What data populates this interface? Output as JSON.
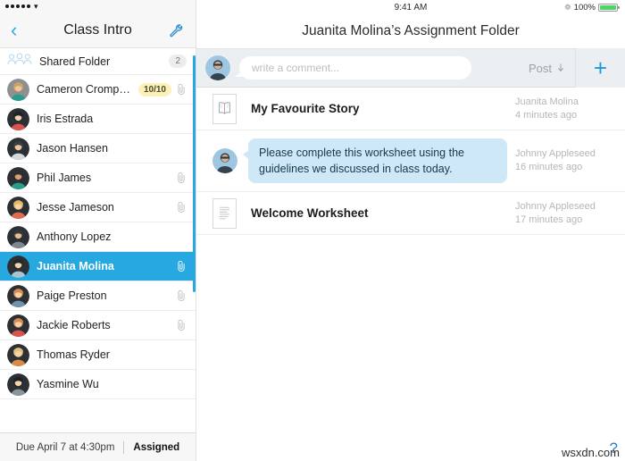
{
  "left": {
    "status_bar": {
      "signal_dots": 5,
      "wifi_icon": "wifi-icon"
    },
    "nav": {
      "back_icon": "back-chevron-icon",
      "title": "Class Intro",
      "settings_icon": "wrench-icon"
    },
    "shared_folder": {
      "icon": "group-people-icon",
      "label": "Shared Folder",
      "count": "2"
    },
    "students": [
      {
        "name": "Cameron Cromp…",
        "grade": "10/10",
        "attachment": true,
        "selected": false,
        "skin": "#f0c79a",
        "hair": "#c9a26b",
        "shirt": "#2a9d8f",
        "bg": "#8f8f8f"
      },
      {
        "name": "Iris Estrada",
        "grade": "",
        "attachment": false,
        "selected": false,
        "skin": "#f3d3ae",
        "hair": "#1f2226",
        "shirt": "#d9534f",
        "bg": "#2c3034"
      },
      {
        "name": "Jason Hansen",
        "grade": "",
        "attachment": false,
        "selected": false,
        "skin": "#f0c79a",
        "hair": "#3b3f45",
        "shirt": "#d6d9dc",
        "bg": "#2c3034"
      },
      {
        "name": "Phil James",
        "grade": "",
        "attachment": true,
        "selected": false,
        "skin": "#d8a06a",
        "hair": "#2b2f33",
        "shirt": "#2a9d8f",
        "bg": "#2c3034"
      },
      {
        "name": "Jesse Jameson",
        "grade": "",
        "attachment": true,
        "selected": false,
        "skin": "#f3d3ae",
        "hair": "#e3b85f",
        "shirt": "#e06a52",
        "bg": "#2c3034"
      },
      {
        "name": "Anthony Lopez",
        "grade": "",
        "attachment": false,
        "selected": false,
        "skin": "#e8bd8e",
        "hair": "#35393e",
        "shirt": "#7e868e",
        "bg": "#2c3034"
      },
      {
        "name": "Juanita Molina",
        "grade": "",
        "attachment": true,
        "selected": true,
        "skin": "#f3d3ae",
        "hair": "#23272b",
        "shirt": "#a8c6cf",
        "bg": "#2c3034"
      },
      {
        "name": "Paige Preston",
        "grade": "",
        "attachment": true,
        "selected": false,
        "skin": "#f3d3ae",
        "hair": "#d88b4e",
        "shirt": "#6f93ab",
        "bg": "#2c3034"
      },
      {
        "name": "Jackie Roberts",
        "grade": "",
        "attachment": true,
        "selected": false,
        "skin": "#f3d3ae",
        "hair": "#d88b4e",
        "shirt": "#d9534f",
        "bg": "#2c3034"
      },
      {
        "name": "Thomas Ryder",
        "grade": "",
        "attachment": false,
        "selected": false,
        "skin": "#f3d3ae",
        "hair": "#e0c07a",
        "shirt": "#d98b45",
        "bg": "#2c3034"
      },
      {
        "name": "Yasmine Wu",
        "grade": "",
        "attachment": false,
        "selected": false,
        "skin": "#f3d3ae",
        "hair": "#1d2024",
        "shirt": "#8b949b",
        "bg": "#2c3034"
      }
    ],
    "footer": {
      "due_text": "Due April 7 at 4:30pm",
      "status_text": "Assigned"
    },
    "scrollbar": {
      "color": "#27a8e0"
    }
  },
  "right": {
    "status_bar": {
      "time": "9:41 AM",
      "bluetooth_icon": "bluetooth-icon",
      "battery_percent": "100%",
      "battery_icon": "battery-full-icon",
      "battery_color": "#4cd664"
    },
    "folder_title": "Juanita Molina’s Assignment Folder",
    "composer": {
      "avatar": "current-user-avatar",
      "placeholder": "write a comment...",
      "value": "",
      "post_label": "Post",
      "post_caret_icon": "dropdown-arrow-icon",
      "add_icon": "plus-icon",
      "accent": "#2196e3"
    },
    "feed": [
      {
        "kind": "document",
        "icon": "book-icon",
        "title": "My Favourite Story",
        "author": "Juanita Molina",
        "time": "4 minutes ago"
      },
      {
        "kind": "message",
        "icon": "teacher-avatar",
        "text": "Please complete this worksheet using the guidelines we discussed in class today.",
        "author": "Johnny Appleseed",
        "time": "16 minutes ago",
        "bubble_color": "#cfe8f7"
      },
      {
        "kind": "document",
        "icon": "worksheet-icon",
        "title": "Welcome Worksheet",
        "author": "Johnny Appleseed",
        "time": "17 minutes ago"
      }
    ]
  },
  "watermark": {
    "text": "wsxdn.com",
    "mark": "?"
  }
}
